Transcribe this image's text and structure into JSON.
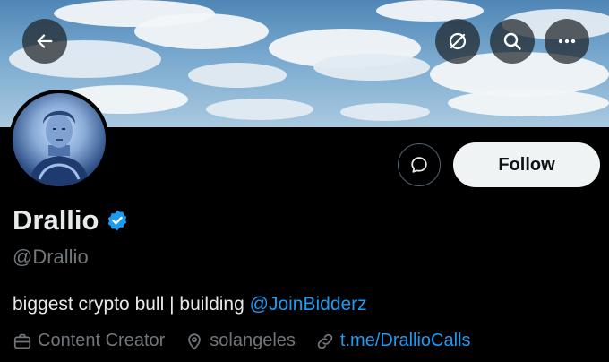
{
  "header": {
    "back_icon": "arrow-left-icon",
    "grok_icon": "slash-circle-icon",
    "search_icon": "search-icon",
    "more_icon": "more-horizontal-icon"
  },
  "actions": {
    "message_icon": "chat-bubble-icon",
    "follow_label": "Follow"
  },
  "profile": {
    "name": "Drallio",
    "verified": true,
    "handle": "@Drallio",
    "bio_text": "biggest crypto bull | building ",
    "bio_mention": "@JoinBidderz",
    "category": "Content Creator",
    "location": "solangeles",
    "link": "t.me/DrallioCalls"
  },
  "colors": {
    "accent": "#1d9bf0",
    "muted": "#71767b",
    "background": "#000000"
  }
}
